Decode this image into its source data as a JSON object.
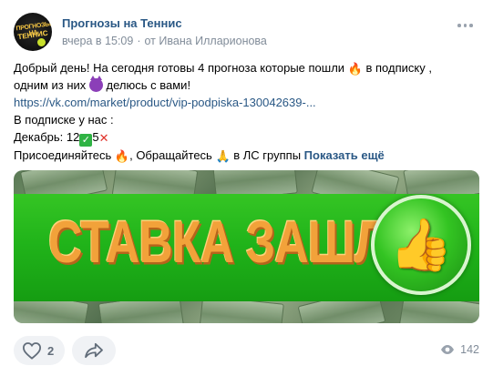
{
  "post": {
    "group_name": "Прогнозы на Теннис",
    "timestamp": "вчера в 15:09",
    "author_prefix": "от",
    "author": "Ивана Илларионова",
    "avatar": {
      "logo_line1": "ПРОГНОЗЫ НА",
      "logo_line2": "ТЕННИС"
    },
    "text": {
      "line1_a": "Добрый день! На сегодня готовы 4 прогноза которые пошли ",
      "line1_b": " в подписку ,",
      "line2_a": "одним из них ",
      "line2_b": " делюсь с вами!",
      "link": "https://vk.com/market/product/vip-podpiska-130042639-...",
      "line4": "В подписке у нас :",
      "line5_a": "Декабрь: 12",
      "line5_b": "5",
      "line6_a": "Присоединяйтесь ",
      "line6_b": ", Обращайтесь ",
      "line6_c": " в ЛС группы ",
      "show_more": "Показать ещё"
    },
    "emoji": {
      "fire": "🔥",
      "devil": "devil-emoji",
      "check": "✓",
      "cross": "✕",
      "pray": "🙏"
    },
    "banner": {
      "title": "СТАВКА ЗАШЛА",
      "icon": "thumbs-up-icon"
    },
    "likes": "2",
    "views": "142"
  },
  "colors": {
    "link": "#2a5885",
    "meta": "#818c99",
    "banner_green": "#21b41a",
    "banner_text": "#f2a23a"
  }
}
